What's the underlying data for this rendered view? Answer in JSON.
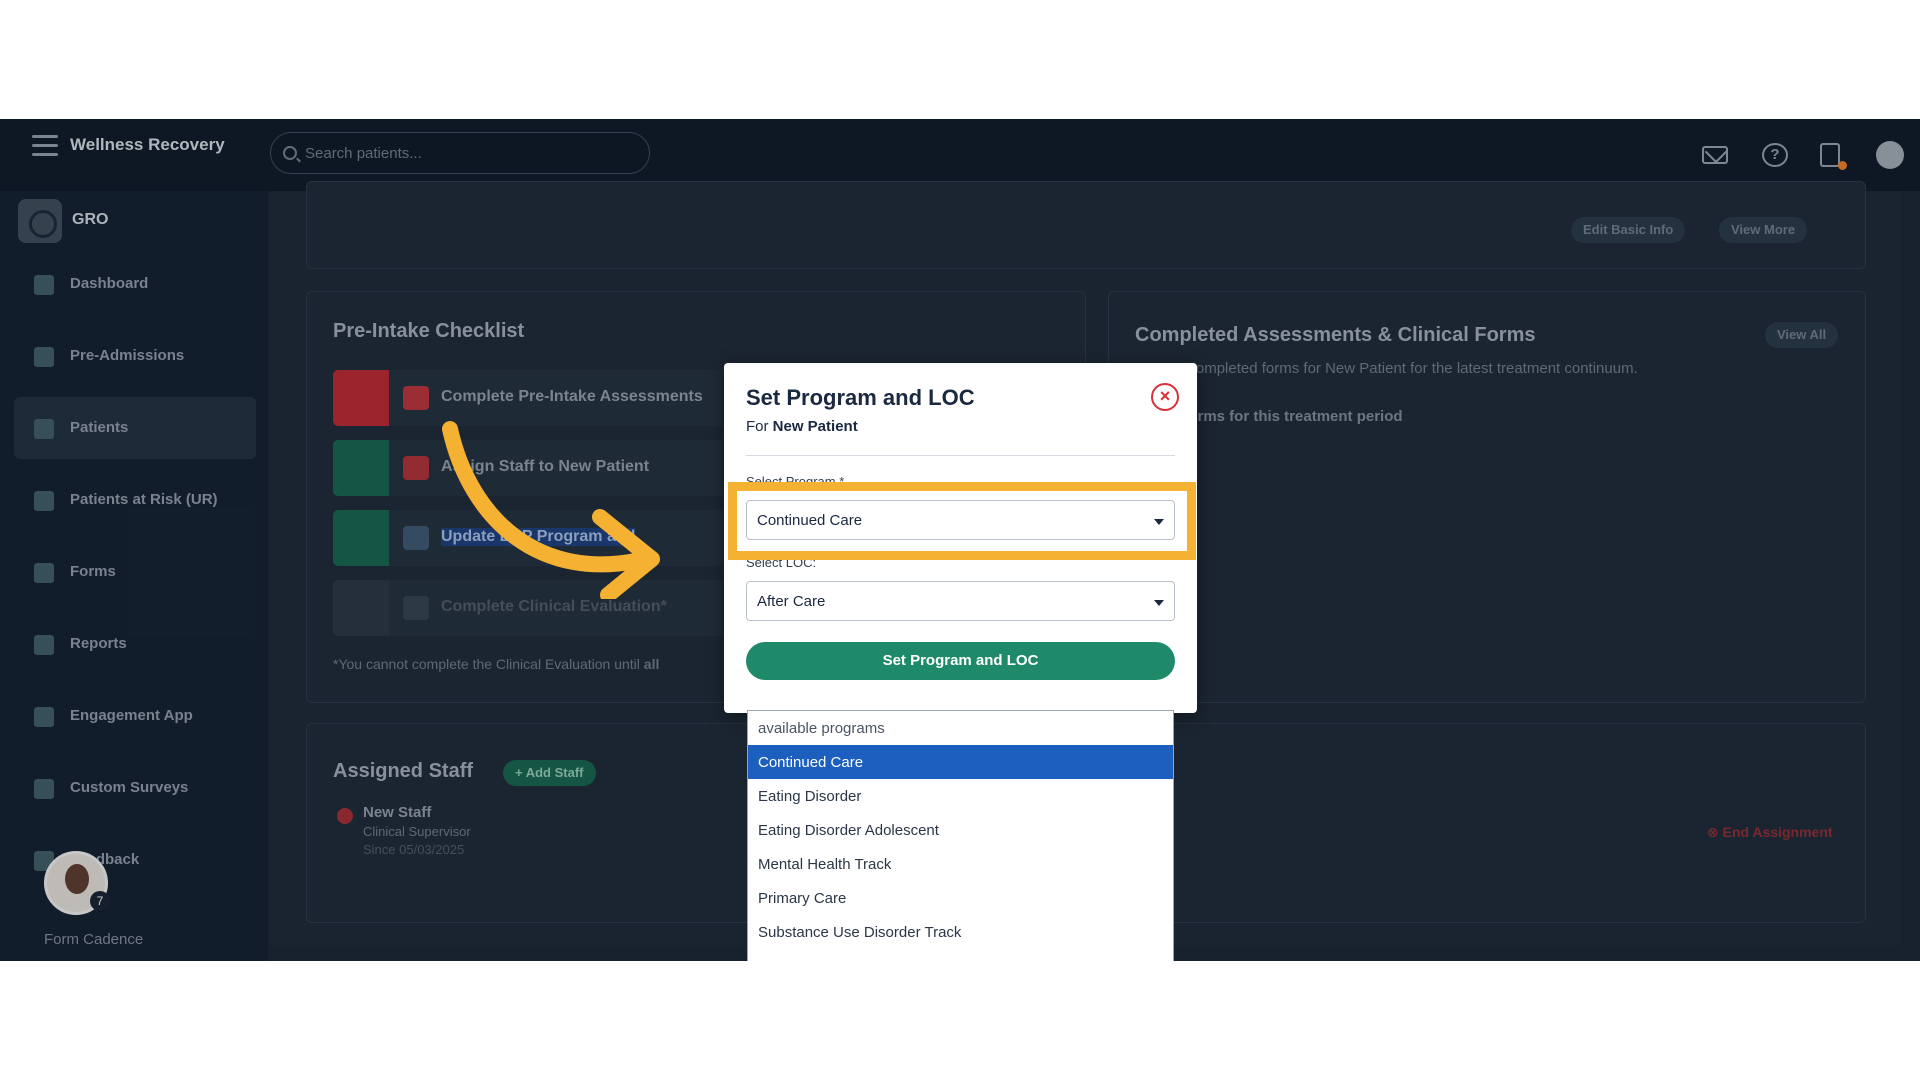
{
  "app": {
    "brand": "Wellness Recovery",
    "org_name": "GRO",
    "search_placeholder": "Search patients..."
  },
  "sidebar": {
    "items": [
      {
        "label": "Dashboard",
        "icon": "dashboard-icon",
        "active": false
      },
      {
        "label": "Pre-Admissions",
        "icon": "pre-admissions-icon",
        "active": false
      },
      {
        "label": "Patients",
        "icon": "patients-icon",
        "active": true
      },
      {
        "label": "Patients at Risk (UR)",
        "icon": "flag-icon",
        "active": false
      },
      {
        "label": "Forms",
        "icon": "forms-icon",
        "active": false
      },
      {
        "label": "Reports",
        "icon": "reports-icon",
        "active": false
      },
      {
        "label": "Engagement App",
        "icon": "engagement-icon",
        "active": false
      },
      {
        "label": "Custom Surveys",
        "icon": "surveys-icon",
        "active": false
      },
      {
        "label": "Feedback",
        "icon": "feedback-icon",
        "active": false
      }
    ],
    "avatar_badge": "7",
    "form_cadence": "Form Cadence"
  },
  "patient_header": {
    "edit_basic_info": "Edit Basic Info",
    "view_more": "View More"
  },
  "checklist": {
    "title": "Pre-Intake Checklist",
    "items": [
      {
        "label": "Complete Pre-Intake Assessments",
        "state": "incomplete",
        "color": "#d9303a"
      },
      {
        "label": "Assign Staff to New Patient",
        "state": "done",
        "color": "#1f8a6a"
      },
      {
        "label": "Update ERP Program and",
        "state": "done",
        "color": "#1f8a6a"
      },
      {
        "label": "Complete Clinical Evaluation*",
        "state": "disabled",
        "color": "#2f3c4b"
      }
    ],
    "footnote_prefix": "*You cannot complete the Clinical Evaluation until",
    "footnote_bold": "all"
  },
  "completed_forms": {
    "title": "Completed Assessments & Clinical Forms",
    "view_all": "View All",
    "subtitle": "Last 10 completed forms for New Patient for the latest treatment continuum.",
    "empty": "pleted forms for this treatment period"
  },
  "assigned_staff": {
    "title": "Assigned Staff",
    "add_button": "+ Add Staff",
    "staff_name": "New Staff",
    "staff_role": "Clinical Supervisor",
    "staff_since": "Since 05/03/2025",
    "end_assignment": "End Assignment"
  },
  "modal": {
    "title": "Set Program and LOC",
    "for_prefix": "For",
    "patient_name": "New Patient",
    "program_label": "Select Program *",
    "program_value": "Continued Care",
    "loc_label": "Select LOC:",
    "loc_value": "After Care",
    "submit_label": "Set Program and LOC"
  },
  "dropdown": {
    "options": [
      {
        "label": "available programs",
        "kind": "header"
      },
      {
        "label": "Continued Care",
        "kind": "selected"
      },
      {
        "label": "Eating Disorder",
        "kind": "option"
      },
      {
        "label": "Eating Disorder Adolescent",
        "kind": "option"
      },
      {
        "label": "Mental Health Track",
        "kind": "option"
      },
      {
        "label": "Primary Care",
        "kind": "option"
      },
      {
        "label": "Substance Use Disorder Track",
        "kind": "option"
      }
    ]
  },
  "colors": {
    "highlight": "#f5b131",
    "accent_green": "#1f8a6a",
    "danger": "#d9303a",
    "selected_blue": "#1d5fbe"
  }
}
